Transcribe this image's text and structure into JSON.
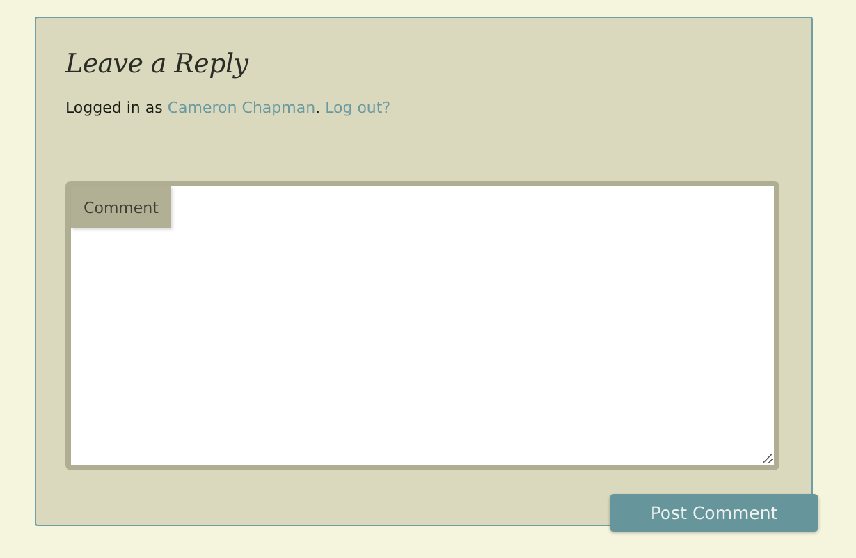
{
  "reply_form": {
    "title": "Leave a Reply",
    "logged_in": {
      "prefix": "Logged in as ",
      "user": "Cameron Chapman",
      "separator": ". ",
      "logout": "Log out?"
    },
    "comment": {
      "label": "Comment"
    },
    "submit": "Post Comment"
  }
}
